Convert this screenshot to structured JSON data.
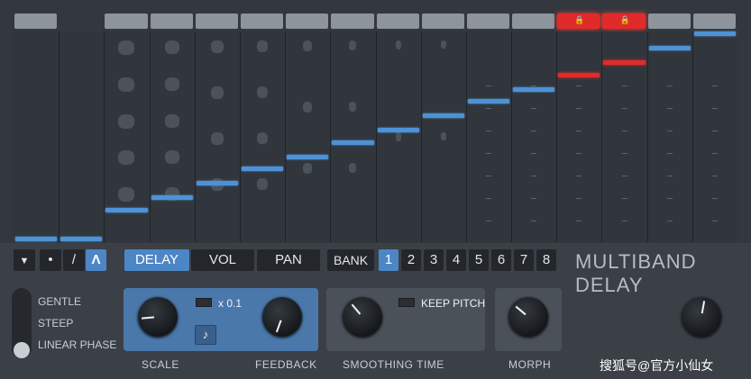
{
  "toolbar": {
    "menu_icon": "triangle-down-icon",
    "shape_buttons": [
      "•",
      "/",
      "Λ"
    ],
    "tabs": [
      "DELAY",
      "VOL",
      "PAN"
    ],
    "active_tab": "DELAY",
    "bank_label": "BANK",
    "bank_numbers": [
      "1",
      "2",
      "3",
      "4",
      "5",
      "6",
      "7",
      "8"
    ],
    "active_bank": "1",
    "title": "MULTIBAND DELAY"
  },
  "band_tabs": {
    "count": 16,
    "locked": [
      12,
      13
    ],
    "lock_icon": "lock-icon"
  },
  "band_levels": [
    0.0,
    0.0,
    0.14,
    0.2,
    0.27,
    0.34,
    0.4,
    0.47,
    0.53,
    0.6,
    0.67,
    0.73,
    0.8,
    0.86,
    0.93,
    1.0
  ],
  "band_level_colors": {
    "normal": "#4d92d6",
    "locked": "#e12b2b"
  },
  "slope": {
    "options": [
      "GENTLE",
      "STEEP",
      "LINEAR PHASE"
    ],
    "selected": "LINEAR PHASE"
  },
  "knobs": {
    "scale": {
      "label": "SCALE",
      "multiplier": "x 0.1",
      "note_icon": "music-note-icon"
    },
    "feedback": {
      "label": "FEEDBACK"
    },
    "smoothing": {
      "label": "SMOOTHING TIME",
      "keep_pitch": "KEEP PITCH"
    },
    "morph": {
      "label": "MORPH"
    },
    "output": {
      "label": ""
    }
  },
  "watermark": "搜狐号@官方小仙女",
  "colors": {
    "accent": "#4d86c6",
    "lock_red": "#e12b2b",
    "background": "#3b4047"
  }
}
